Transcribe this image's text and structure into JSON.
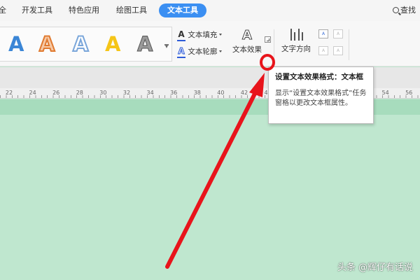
{
  "tabs": [
    {
      "label": "全"
    },
    {
      "label": "开发工具"
    },
    {
      "label": "特色应用"
    },
    {
      "label": "绘图工具"
    },
    {
      "label": "文本工具"
    }
  ],
  "search": {
    "label": "查找"
  },
  "wordart": {
    "letter": "A"
  },
  "ribbon": {
    "fill_label": "文本填充",
    "outline_label": "文本轮廓",
    "effect_label": "文本效果",
    "direction_label": "文字方向",
    "icon_glyph": "A"
  },
  "ruler": {
    "ticks": [
      "22",
      "24",
      "26",
      "28",
      "30",
      "32",
      "34",
      "36",
      "38",
      "40",
      "42",
      "44",
      "46",
      "48",
      "50",
      "52",
      "54",
      "56"
    ]
  },
  "tooltip": {
    "title": "设置文本效果格式：文本框",
    "body": "显示“设置文本效果格式”任务窗格以更改文本框属性。"
  },
  "annotation": {
    "color": "#e8141b"
  },
  "colors": {
    "accent": "#3b8ff2",
    "canvas": "#bfe7cf"
  },
  "watermark": {
    "text": "头条 @辉仔有话说"
  }
}
